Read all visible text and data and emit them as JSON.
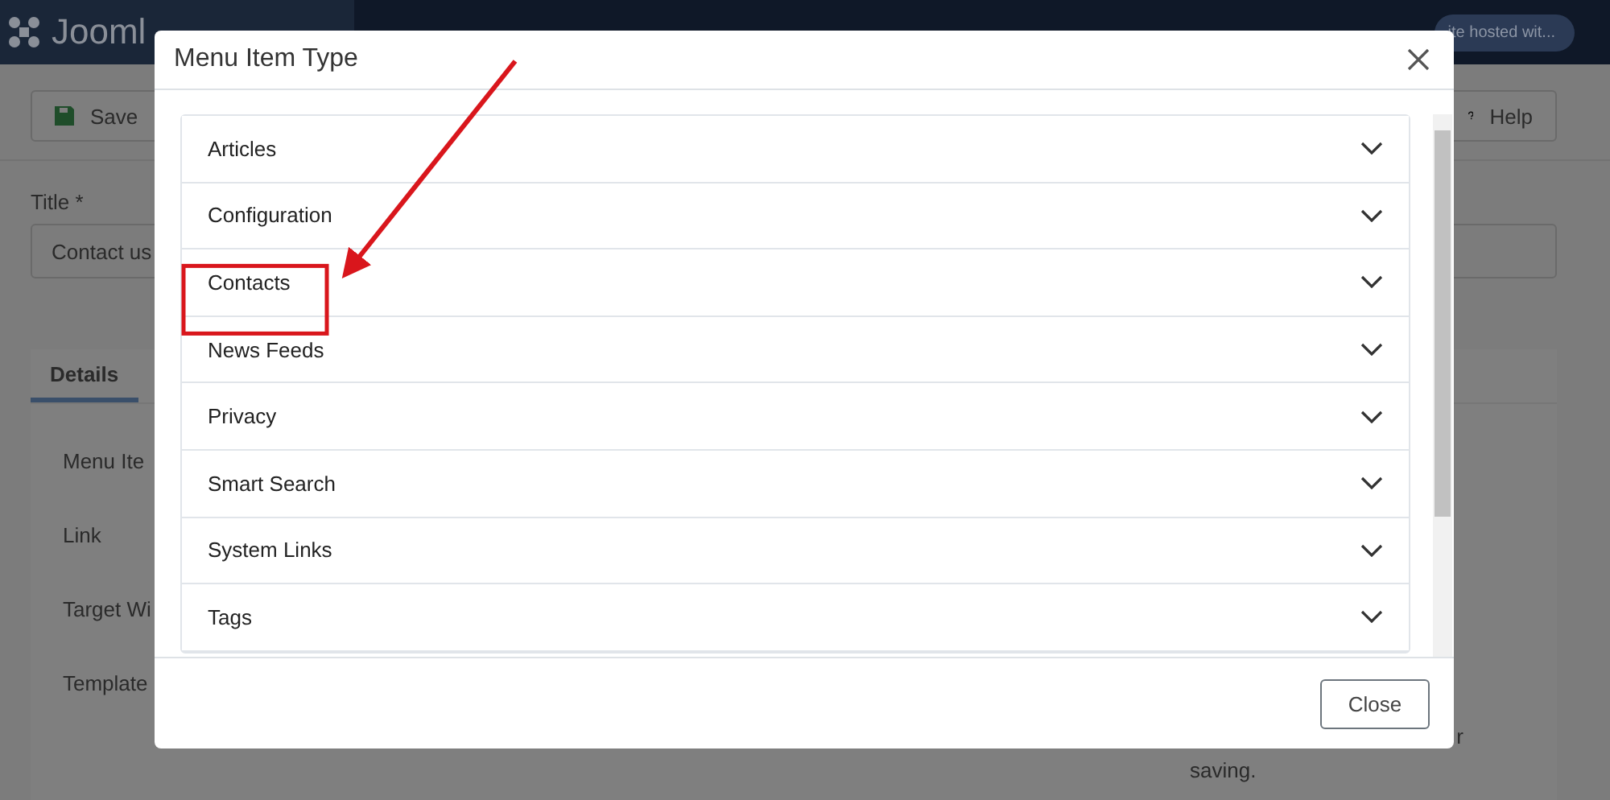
{
  "header": {
    "logo": "Jooml",
    "site_label": "ite hosted wit..."
  },
  "toolbar": {
    "buttons": [
      {
        "kind": "save",
        "label": "Save"
      },
      {
        "kind": "help",
        "label": "Help"
      }
    ]
  },
  "title_field": {
    "label": "Title *",
    "value": "Contact us"
  },
  "tabs": [
    {
      "label": "Details",
      "selected": true
    }
  ],
  "form_labels": [
    "Menu Ite",
    "Link",
    "Target Wi",
    "Template"
  ],
  "side_note": {
    "lines": [
      "r",
      "saving."
    ]
  },
  "modal": {
    "title": "Menu Item Type",
    "items": [
      {
        "label": "Articles",
        "expanded": false
      },
      {
        "label": "Configuration",
        "expanded": false
      },
      {
        "label": "Contacts",
        "expanded": false,
        "highlighted": true
      },
      {
        "label": "News Feeds",
        "expanded": false
      },
      {
        "label": "Privacy",
        "expanded": false
      },
      {
        "label": "Smart Search",
        "expanded": false
      },
      {
        "label": "System Links",
        "expanded": false
      },
      {
        "label": "Tags",
        "expanded": false
      }
    ],
    "close_button": "Close"
  }
}
